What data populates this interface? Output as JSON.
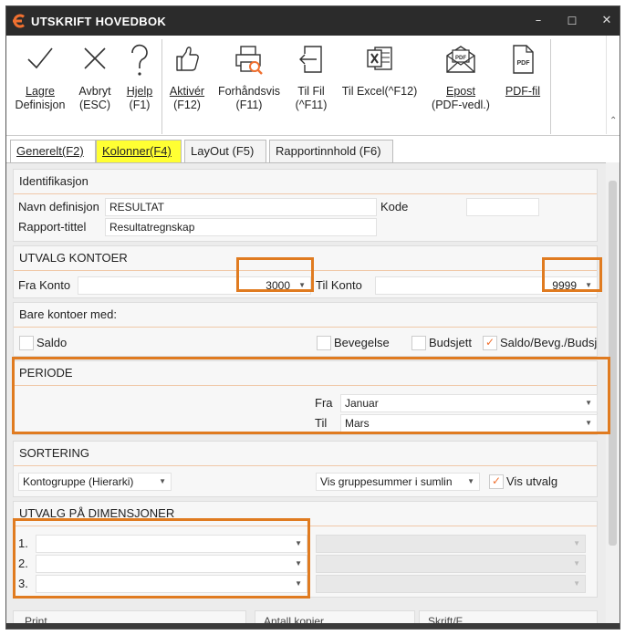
{
  "window": {
    "title": "UTSKRIFT  HOVEDBOK",
    "minimize": "–",
    "maximize": "☐",
    "close": "✕"
  },
  "toolbar": [
    {
      "id": "lagre",
      "label1": "Lagre",
      "label2": "Definisjon",
      "icon": "checkmark-icon"
    },
    {
      "id": "avbryt",
      "label1": "Avbryt",
      "label2": "(ESC)",
      "icon": "x-icon"
    },
    {
      "id": "hjelp",
      "label1": "Hjelp",
      "label2": "(F1)",
      "icon": "question-icon"
    },
    {
      "id": "aktiver",
      "label1": "Aktivér",
      "label2": "(F12)",
      "icon": "thumbs-up-icon"
    },
    {
      "id": "forhandsvis",
      "label1": "Forhåndsvis",
      "label2": "(F11)",
      "icon": "printer-preview-icon"
    },
    {
      "id": "tilfil",
      "label1": "Til Fil",
      "label2": "(^F11)",
      "icon": "export-file-icon"
    },
    {
      "id": "tilexcel",
      "label1": "Til Excel(^F12)",
      "label2": "",
      "icon": "excel-icon"
    },
    {
      "id": "epost",
      "label1": "Epost",
      "label2": "(PDF-vedl.)",
      "icon": "pdf-email-icon"
    },
    {
      "id": "pdffil",
      "label1": "PDF-fil",
      "label2": "",
      "icon": "pdf-file-icon"
    }
  ],
  "tabs": [
    {
      "label": "Generelt(F2)",
      "active": true
    },
    {
      "label": "Kolonner(F4)",
      "highlight": true
    },
    {
      "label": "LayOut (F5)"
    },
    {
      "label": "Rapportinnhold (F6)"
    }
  ],
  "identifikasjon": {
    "header": "Identifikasjon",
    "navn_label": "Navn definisjon",
    "navn_value": "RESULTAT",
    "kode_label": "Kode",
    "kode_value": "",
    "tittel_label": "Rapport-tittel",
    "tittel_value": "Resultatregnskap"
  },
  "utvalg": {
    "header": "UTVALG KONTOER",
    "fra_label": "Fra Konto",
    "fra_value": "3000",
    "til_label": "Til Konto",
    "til_value": "9999"
  },
  "bare": {
    "header": "Bare kontoer med:",
    "saldo": "Saldo",
    "saldo_checked": false,
    "bevegelse": "Bevegelse",
    "bevegelse_checked": false,
    "budsjett": "Budsjett",
    "budsjett_checked": false,
    "saldo_bevg": "Saldo/Bevg./Budsj",
    "saldo_bevg_checked": true
  },
  "periode": {
    "header": "PERIODE",
    "fra_label": "Fra",
    "fra_value": "Januar",
    "til_label": "Til",
    "til_value": "Mars"
  },
  "sortering": {
    "header": "SORTERING",
    "sort_value": "Kontogruppe (Hierarki)",
    "gruppe_value": "Vis gruppesummer i sumlin",
    "vis_utvalg": "Vis utvalg",
    "vis_utvalg_checked": true
  },
  "dimensjoner": {
    "header": "UTVALG PÅ DIMENSJONER",
    "rows": [
      "1.",
      "2.",
      "3."
    ]
  },
  "partial_text": [
    "Print",
    "Antall kopier",
    "Skrift/F"
  ],
  "colors": {
    "accent": "#f07030",
    "highlight_border": "#e07b20",
    "tab_highlight": "#ffff33",
    "titlebar": "#2b2b2b"
  }
}
